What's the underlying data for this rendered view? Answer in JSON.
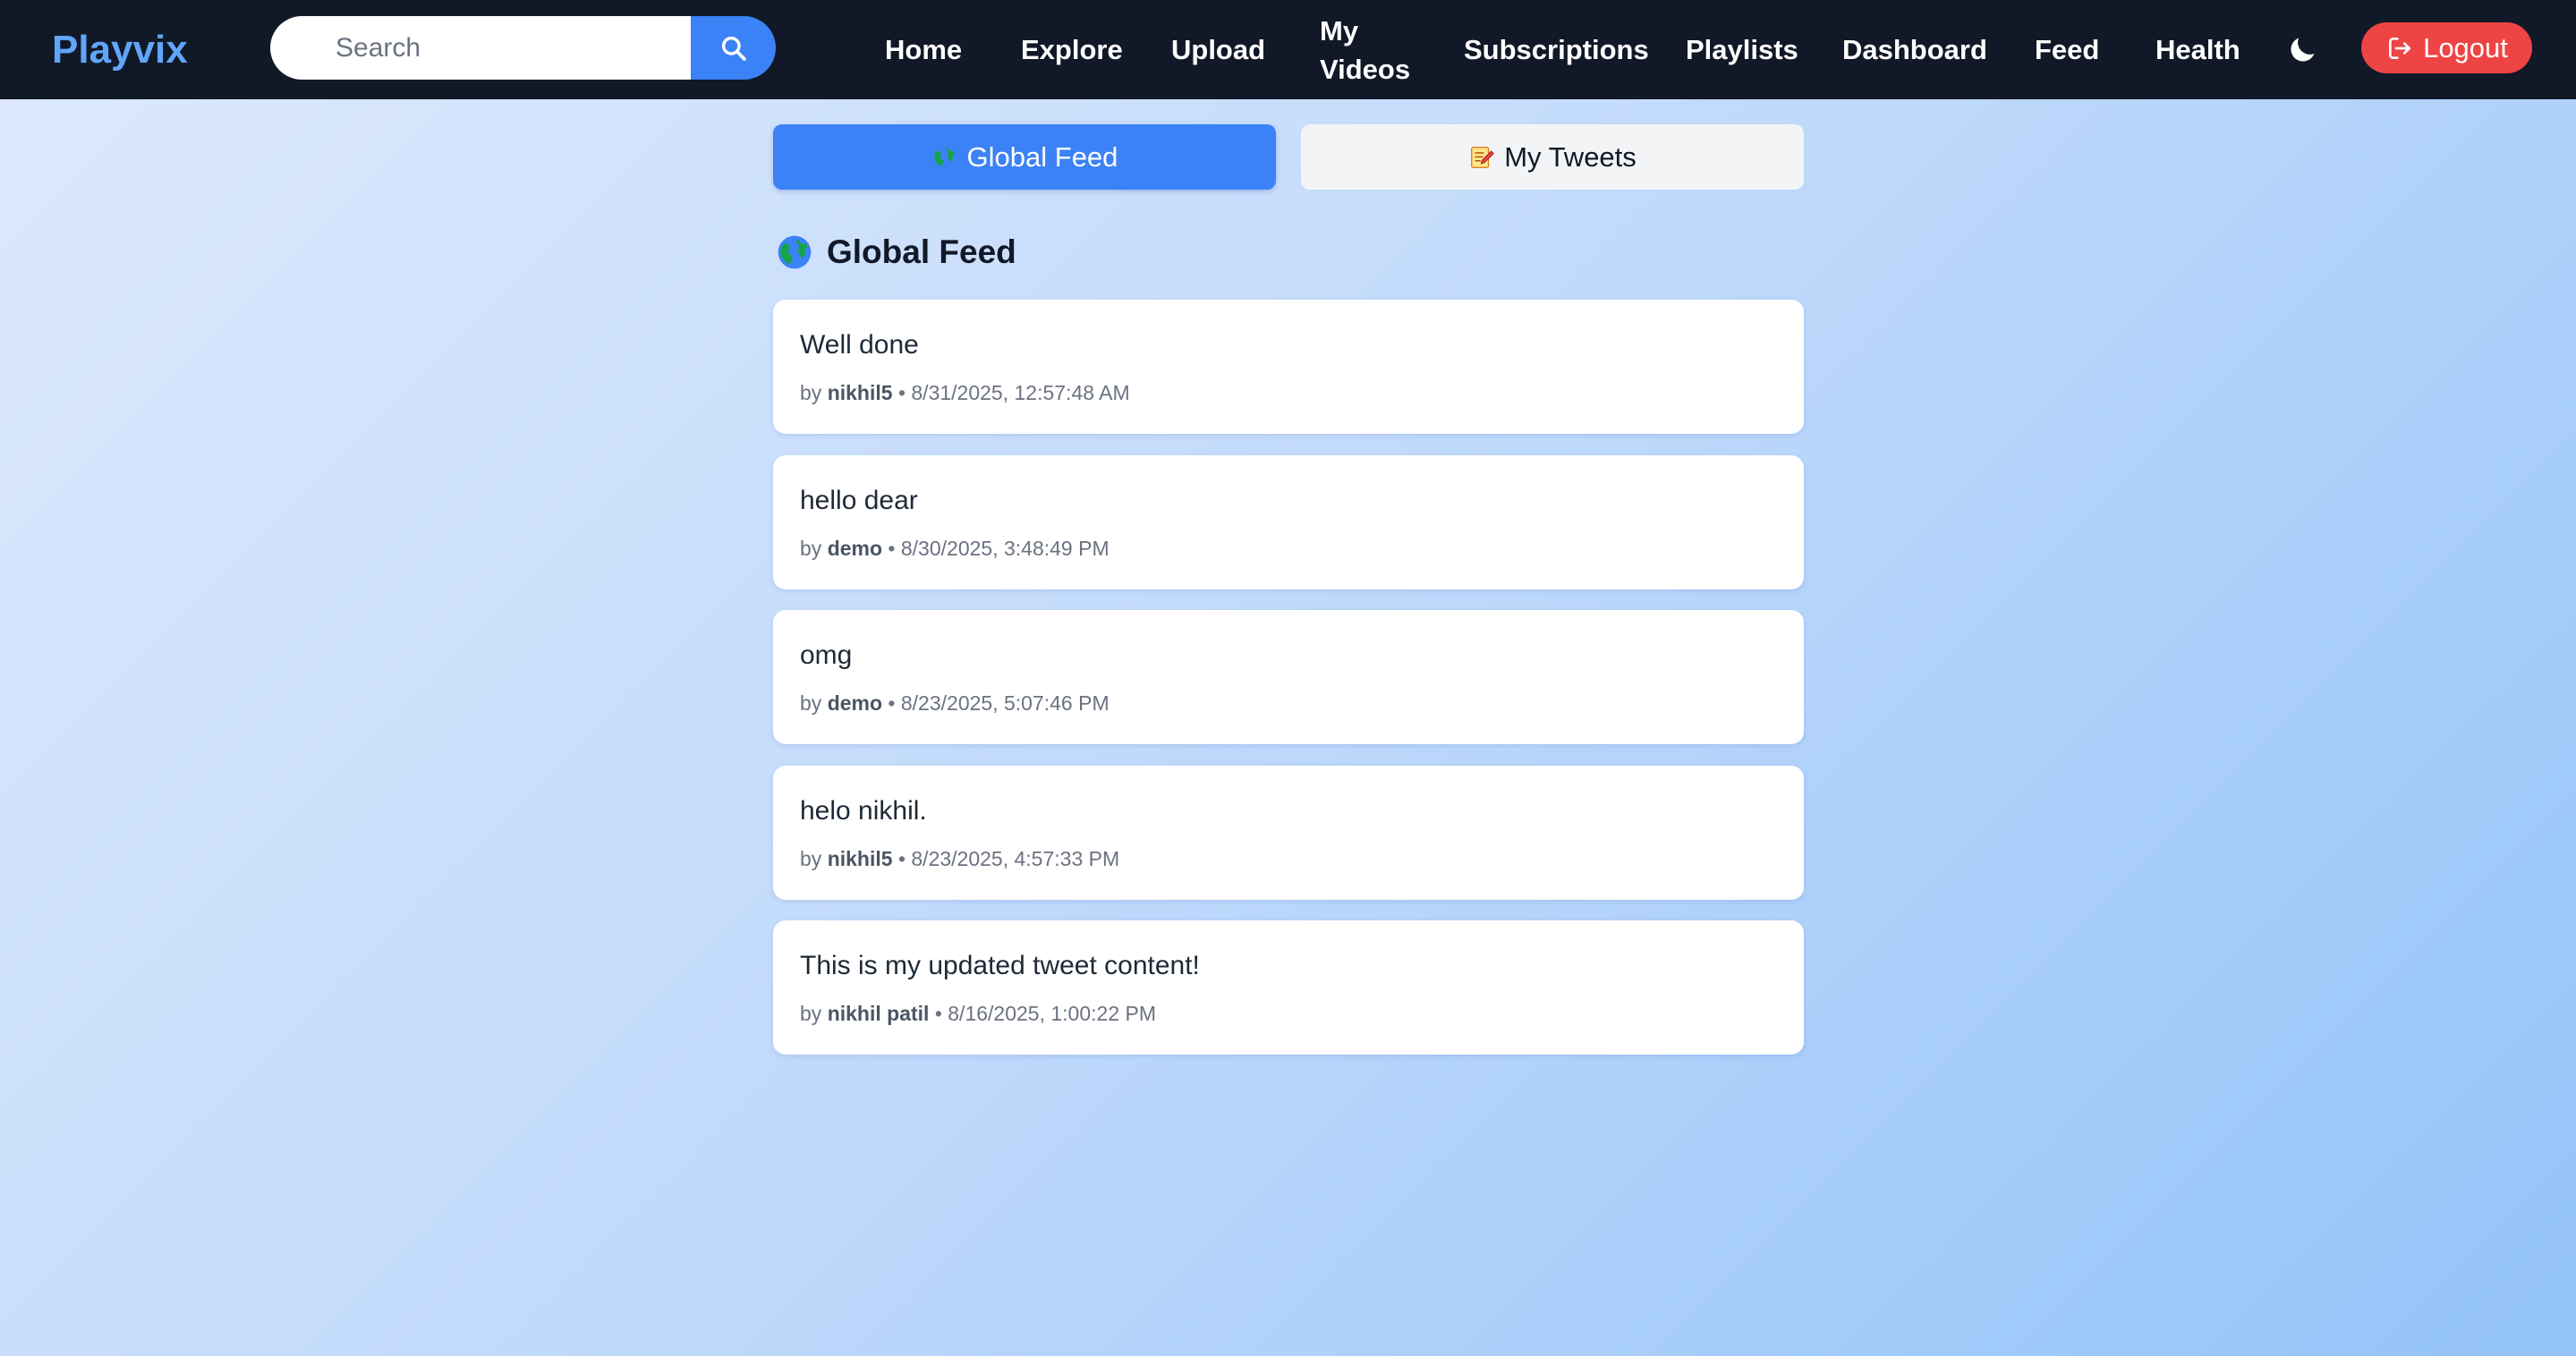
{
  "navbar": {
    "brand": "Playvix",
    "search": {
      "placeholder": "Search",
      "value": "",
      "button_icon": "search-icon"
    },
    "links": [
      {
        "label": "Home"
      },
      {
        "label": "Explore"
      },
      {
        "label": "Upload"
      },
      {
        "label": "My Videos"
      },
      {
        "label": "Subscriptions"
      },
      {
        "label": "Playlists"
      },
      {
        "label": "Dashboard"
      },
      {
        "label": "Feed"
      },
      {
        "label": "Health"
      }
    ],
    "theme_toggle_icon": "moon-icon",
    "logout": {
      "label": "Logout",
      "icon": "logout-icon"
    }
  },
  "tabs": [
    {
      "label": "Global Feed",
      "icon": "globe-emoji",
      "active": true
    },
    {
      "label": "My Tweets",
      "icon": "memo-emoji",
      "active": false
    }
  ],
  "section": {
    "title": "Global Feed",
    "icon": "globe-emoji"
  },
  "tweets": [
    {
      "content": "Well done",
      "by": "by",
      "author": "nikhil5",
      "separator": "•",
      "timestamp": "8/31/2025, 12:57:48 AM"
    },
    {
      "content": "hello dear",
      "by": "by",
      "author": "demo",
      "separator": "•",
      "timestamp": "8/30/2025, 3:48:49 PM"
    },
    {
      "content": "omg",
      "by": "by",
      "author": "demo",
      "separator": "•",
      "timestamp": "8/23/2025, 5:07:46 PM"
    },
    {
      "content": "helo nikhil.",
      "by": "by",
      "author": "nikhil5",
      "separator": "•",
      "timestamp": "8/23/2025, 4:57:33 PM"
    },
    {
      "content": "This is my updated tweet content!",
      "by": "by",
      "author": "nikhil patil",
      "separator": "•",
      "timestamp": "8/16/2025, 1:00:22 PM"
    }
  ],
  "colors": {
    "navbar_bg": "#111827",
    "brand": "#60a5fa",
    "accent": "#3b82f6",
    "logout": "#ef4444",
    "inactive_tab": "#f3f4f6"
  }
}
